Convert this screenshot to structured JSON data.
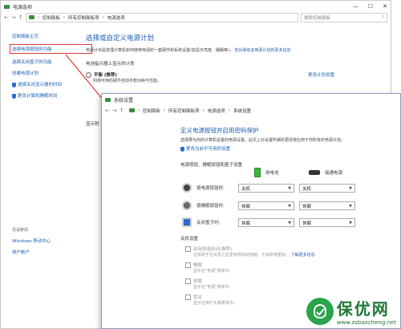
{
  "win1": {
    "title": "电源选项",
    "address": [
      "控制面板",
      "所有控制面板项",
      "电源选项"
    ],
    "search_placeholder": "搜索控制面板",
    "sidebar": {
      "items": [
        {
          "label": "控制面板主页"
        },
        {
          "label": "选择电源按钮的功能"
        },
        {
          "label": "选择关闭盖子的功能"
        },
        {
          "label": "创建电源计划"
        },
        {
          "label": "选择关闭显示器的时间"
        },
        {
          "label": "更改计算机睡眠时间"
        }
      ],
      "see_also_title": "另请参阅",
      "see_also": [
        {
          "label": "Windows 移动中心"
        },
        {
          "label": "用户帐户"
        }
      ]
    },
    "main": {
      "title": "选择或自定义电源计划",
      "description": "电源计划是管理计算机如何使用电源的一套硬件和系统设置(如显示亮度、睡眠等)。",
      "description_link": "告诉我有关电源计划的更多信息",
      "group_label": "电池指示器上显示的计划",
      "plan_name": "平衡 (推荐)",
      "plan_desc": "利用可用的硬件自动平衡功耗与性能。",
      "plan_link": "更改计划设置",
      "cut_label": "显示附"
    }
  },
  "win2": {
    "title": "系统设置",
    "address": [
      "控制面板",
      "所有控制面板项",
      "电源选项",
      "系统设置"
    ],
    "heading": "定义电源按钮并启用密码保护",
    "desc": "选择要为你的计算机设置的电源设置。此页上对设置所做的更改将应用于你所有的电源计划。",
    "change_link": "更改当前不可用的设置",
    "group1": "电源按钮、睡眠按钮和盖子设置",
    "col_battery": "用电池",
    "col_plugged": "接通电源",
    "rows": [
      {
        "label": "按电源按钮时:",
        "battery": "关机",
        "plugged": "关机"
      },
      {
        "label": "按睡眠按钮时:",
        "battery": "休眠",
        "plugged": "休眠"
      },
      {
        "label": "关闭盖子时:",
        "battery": "休眠",
        "plugged": "休眠"
      }
    ],
    "group2": "关机设置",
    "checks": [
      {
        "label": "启用快速启动(推荐)",
        "sub": "这有助于在关机之后更快地启动电脑。不会影响重启。",
        "sub_link": "了解更多信息"
      },
      {
        "label": "睡眠",
        "sub": "显示在\"电源\"菜单中。"
      },
      {
        "label": "休眠",
        "sub": "显示在\"电源\"菜单中。"
      },
      {
        "label": "锁定",
        "sub": "显示在用户头像菜单中。"
      }
    ]
  },
  "watermark": {
    "big": "保优网",
    "small": "www.zsbaocheng.net"
  },
  "colors": {
    "link": "#1a5fb4",
    "highlight": "#e03a3a",
    "brand": "#2aa44a"
  }
}
